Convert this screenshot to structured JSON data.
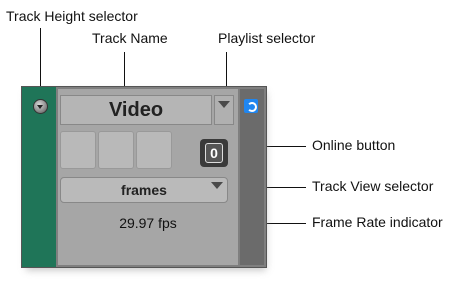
{
  "callouts": {
    "track_height_selector": "Track Height selector",
    "track_name": "Track Name",
    "playlist_selector": "Playlist selector",
    "online_button": "Online button",
    "track_view_selector": "Track View selector",
    "frame_rate_indicator": "Frame Rate indicator"
  },
  "track": {
    "name": "Video",
    "online_label": "0",
    "view": "frames",
    "frame_rate": "29.97 fps"
  },
  "colors": {
    "track_strip": "#1f7558",
    "blue_icon": "#1f86f0"
  },
  "icons": {
    "height": "chevron-down-icon",
    "playlist": "triangle-down-icon",
    "view": "triangle-down-icon",
    "blue": "refresh-icon"
  }
}
